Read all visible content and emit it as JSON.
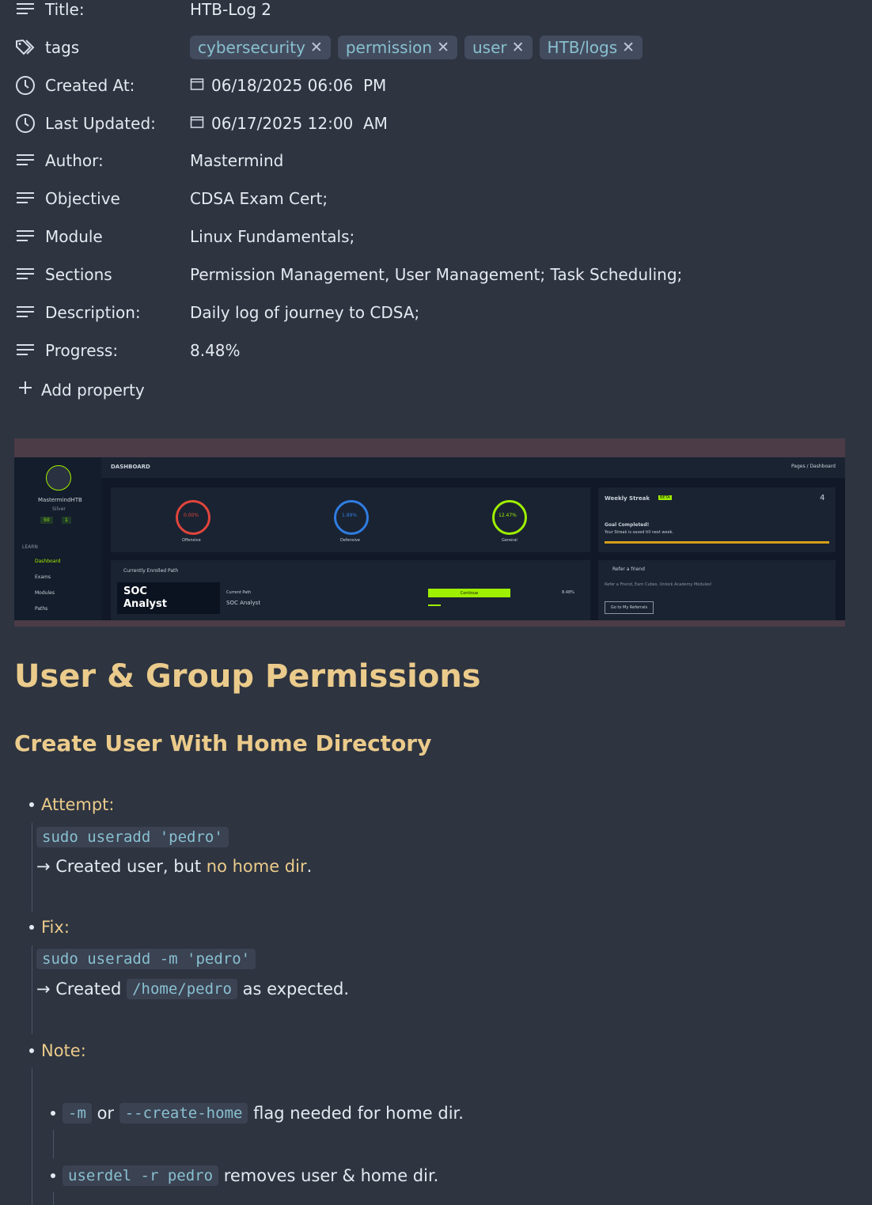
{
  "properties": [
    {
      "icon": "lines-icon",
      "key": "Title:",
      "value": "HTB-Log 2"
    },
    {
      "icon": "tags-icon",
      "key": "tags",
      "tags": [
        "cybersecurity",
        "permission",
        "user",
        "HTB/logs"
      ]
    },
    {
      "icon": "clock-icon",
      "key": "Created At:",
      "date": "06/18/2025 06:06  PM"
    },
    {
      "icon": "clock-icon",
      "key": "Last Updated:",
      "date": "06/17/2025 12:00  AM"
    },
    {
      "icon": "lines-icon",
      "key": "Author:",
      "value": "Mastermind"
    },
    {
      "icon": "lines-icon",
      "key": "Objective",
      "value": "CDSA Exam Cert;"
    },
    {
      "icon": "lines-icon",
      "key": "Module",
      "value": "Linux Fundamentals;"
    },
    {
      "icon": "lines-icon",
      "key": "Sections",
      "value": "Permission Management, User Management; Task Scheduling;"
    },
    {
      "icon": "lines-icon",
      "key": "Description:",
      "value": "Daily log of journey to CDSA;"
    },
    {
      "icon": "lines-icon",
      "key": "Progress:",
      "value": "8.48%"
    }
  ],
  "add_property": "Add property",
  "screenshot": {
    "header": "DASHBOARD",
    "breadcrumb": "Pages / Dashboard",
    "username": "MastermindHTB",
    "rank": "Silver",
    "stat_a": "50",
    "stat_b": "1",
    "learn": "LEARN",
    "nav": [
      "Dashboard",
      "Exams",
      "Modules",
      "Paths"
    ],
    "gauges": [
      {
        "value": "0.00%",
        "label": "Offensive",
        "color": "#e0453c"
      },
      {
        "value": "1.89%",
        "label": "Defensive",
        "color": "#2f7de1"
      },
      {
        "value": "12.47%",
        "label": "General",
        "color": "#9fef00"
      }
    ],
    "streak_title": "Weekly Streak",
    "streak_badge": "BETA",
    "streak_count": "4",
    "goal": "Goal Completed!",
    "goal_sub": "Your Streak is saved till next week.",
    "enrolled": "Currently Enrolled Path",
    "path_card_line1": "SOC",
    "path_card_line2": "Analyst",
    "current_path_label": "Current Path",
    "current_path": "SOC Analyst",
    "continue": "Continue",
    "path_progress": "8.48%",
    "refer_title": "Refer a friend",
    "refer_text": "Refer a Friend, Earn Cubes, Unlock Academy Modules!",
    "refer_button": "Go to My Referrals"
  },
  "content": {
    "h1": "User & Group Permissions",
    "h2": "Create User With Home Directory",
    "attempt_label": "Attempt:",
    "attempt_code": "sudo useradd 'pedro'",
    "attempt_result_a": "→ Created user, but ",
    "attempt_result_hl": "no home dir",
    "attempt_result_b": ".",
    "fix_label": "Fix:",
    "fix_code": "sudo useradd -m 'pedro'",
    "fix_result_a": "→ Created ",
    "fix_result_code": "/home/pedro",
    "fix_result_b": " as expected.",
    "note_label": "Note:",
    "note1_code_a": "-m",
    "note1_or": " or ",
    "note1_code_b": "--create-home",
    "note1_text": " flag needed for home dir.",
    "note2_code": "userdel -r pedro",
    "note2_text": " removes user & home dir."
  }
}
